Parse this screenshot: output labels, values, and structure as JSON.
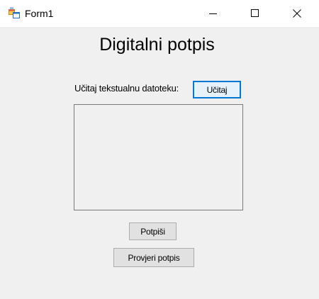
{
  "window": {
    "title": "Form1"
  },
  "caption_buttons": {
    "minimize_icon": "minimize-icon",
    "maximize_icon": "maximize-icon",
    "close_icon": "close-icon"
  },
  "form": {
    "heading": "Digitalni potpis",
    "load_label": "Učitaj tekstualnu datoteku:",
    "load_button": "Učitaj",
    "text_content": "",
    "sign_button": "Potpiši",
    "verify_button": "Provjeri potpis"
  },
  "colors": {
    "form_background": "#f0f0f0",
    "titlebar_background": "#ffffff",
    "default_button_border": "#0078d7",
    "button_background": "#e1e1e1",
    "button_border": "#adadad"
  }
}
